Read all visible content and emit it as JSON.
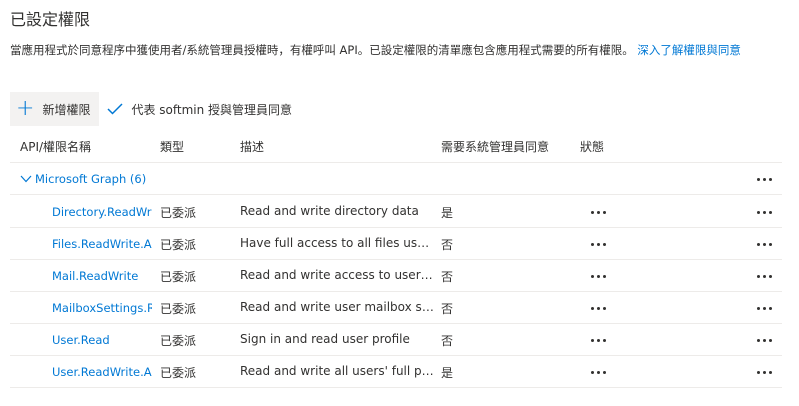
{
  "page": {
    "title": "已設定權限",
    "description": "當應用程式於同意程序中獲使用者/系統管理員授權時，有權呼叫 API。已設定權限的清單應包含應用程式需要的所有權限。",
    "learn_more": "深入了解權限與同意"
  },
  "toolbar": {
    "add_label": "新增權限",
    "grant_label": "代表 softmin 授與管理員同意"
  },
  "table": {
    "headers": {
      "name": "API/權限名稱",
      "type": "類型",
      "description": "描述",
      "admin_consent": "需要系統管理員同意",
      "status": "狀態"
    },
    "group": {
      "label": "Microsoft Graph (6)"
    },
    "rows": [
      {
        "name": "Directory.ReadWrite.All",
        "type": "已委派",
        "description": "Read and write directory data",
        "admin_consent": "是"
      },
      {
        "name": "Files.ReadWrite.All",
        "type": "已委派",
        "description": "Have full access to all files user can access",
        "admin_consent": "否"
      },
      {
        "name": "Mail.ReadWrite",
        "type": "已委派",
        "description": "Read and write access to user mail",
        "admin_consent": "否"
      },
      {
        "name": "MailboxSettings.ReadWrite",
        "type": "已委派",
        "description": "Read and write user mailbox settings",
        "admin_consent": "否"
      },
      {
        "name": "User.Read",
        "type": "已委派",
        "description": "Sign in and read user profile",
        "admin_consent": "否"
      },
      {
        "name": "User.ReadWrite.All",
        "type": "已委派",
        "description": "Read and write all users' full profiles",
        "admin_consent": "是"
      }
    ]
  },
  "colors": {
    "accent": "#0078d4",
    "text": "#323130",
    "divider": "#edebe9"
  },
  "icons": {
    "add": "plus-icon",
    "grant": "checkmark-icon",
    "collapse": "chevron-down-icon",
    "more": "more-icon"
  }
}
